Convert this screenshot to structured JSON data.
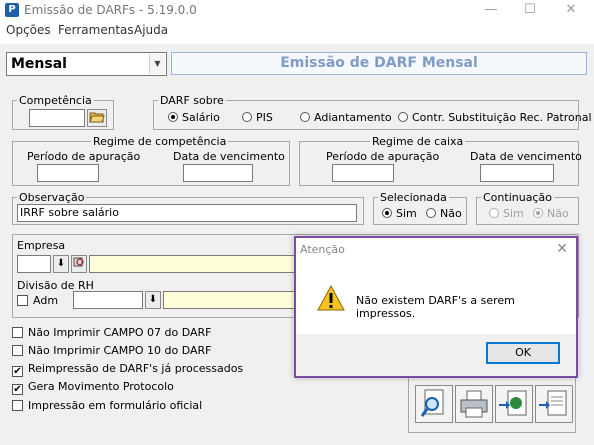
{
  "window": {
    "title": "Emissão de DARFs - 5.19.0.0",
    "app_icon": "P",
    "minimize_glyph": "—",
    "maximize_glyph": "☐",
    "close_glyph": "✕"
  },
  "menu": [
    "Opções",
    "Ferramentas",
    "Ajuda"
  ],
  "mode_combo": {
    "selected": "Mensal",
    "arrow": "▼"
  },
  "headline": "Emissão de DARF Mensal",
  "competencia": {
    "legend": "Competência",
    "value": ""
  },
  "darf_sobre": {
    "legend": "DARF sobre",
    "options": [
      {
        "label": "Salário",
        "checked": true
      },
      {
        "label": "PIS",
        "checked": false
      },
      {
        "label": "Adiantamento",
        "checked": false
      },
      {
        "label": "Contr. Substituição Rec. Patronal",
        "checked": false
      }
    ]
  },
  "regime_competencia": {
    "legend": "Regime de competência",
    "periodo_label": "Período de apuração",
    "vencimento_label": "Data de vencimento"
  },
  "regime_caixa": {
    "legend": "Regime de caixa",
    "periodo_label": "Período de apuração",
    "vencimento_label": "Data de vencimento"
  },
  "observacao": {
    "legend": "Observação",
    "value": "IRRF sobre salário"
  },
  "selecionada": {
    "legend": "Selecionada",
    "options": [
      {
        "label": "Sim",
        "checked": true
      },
      {
        "label": "Não",
        "checked": false
      }
    ]
  },
  "continuacao": {
    "legend": "Continuação",
    "options": [
      {
        "label": "Sim",
        "checked": false
      },
      {
        "label": "Não",
        "checked": true
      }
    ]
  },
  "empresa": {
    "label": "Empresa",
    "lookup_glyph": "⬇"
  },
  "divisao": {
    "label": "Divisão de RH",
    "adm_label": "Adm",
    "lookup_glyph": "⬇"
  },
  "options": [
    {
      "label": "Não Imprimir CAMPO 07 do DARF",
      "checked": false
    },
    {
      "label": "Não Imprimir CAMPO 10 do DARF",
      "checked": false
    },
    {
      "label": "Reimpressão de DARF's já processados",
      "checked": true
    },
    {
      "label": "Gera Movimento Protocolo",
      "checked": true
    },
    {
      "label": "Impressão em formulário oficial",
      "checked": false
    }
  ],
  "check_glyph": "✔",
  "toolbar": [
    "preview-icon",
    "printer-icon",
    "export-icon",
    "document-export-icon"
  ],
  "dialog": {
    "title": "Atenção",
    "close_glyph": "✕",
    "message": "Não existem DARF's a serem impressos.",
    "ok_label": "OK"
  }
}
